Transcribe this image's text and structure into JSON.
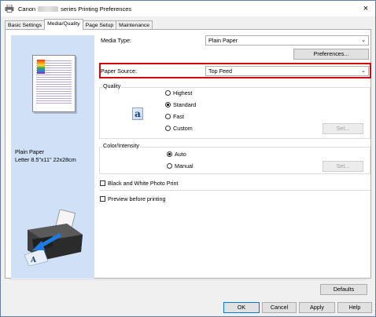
{
  "window": {
    "title_prefix": "Canon",
    "title_suffix": "series Printing Preferences",
    "close_glyph": "×"
  },
  "tabs": [
    {
      "label": "Basic Settings",
      "active": false
    },
    {
      "label": "Media/Quality",
      "active": true
    },
    {
      "label": "Page Setup",
      "active": false
    },
    {
      "label": "Maintenance",
      "active": false
    }
  ],
  "preview": {
    "media_name": "Plain Paper",
    "media_size": "Letter 8.5\"x11\" 22x28cm"
  },
  "media": {
    "media_type_label": "Media Type:",
    "media_type_value": "Plain Paper",
    "preferences_button": "Preferences...",
    "paper_source_label": "Paper Source:",
    "paper_source_value": "Top Feed"
  },
  "quality": {
    "title": "Quality",
    "options": [
      "Highest",
      "Standard",
      "Fast",
      "Custom"
    ],
    "selected": "Standard",
    "icon_glyph": "a",
    "set_button": "Set..."
  },
  "color": {
    "title": "Color/Intensity",
    "options": [
      "Auto",
      "Manual"
    ],
    "selected": "Auto",
    "set_button": "Set..."
  },
  "checks": {
    "bw_photo": "Black and White Photo Print",
    "preview_before": "Preview before printing"
  },
  "footer": {
    "defaults": "Defaults",
    "ok": "OK",
    "cancel": "Cancel",
    "apply": "Apply",
    "help": "Help"
  },
  "icons": {
    "dropdown_arrow": "⌄"
  },
  "colors": {
    "highlight": "#d10a0a",
    "preview_bg": "#cfe0f7"
  }
}
